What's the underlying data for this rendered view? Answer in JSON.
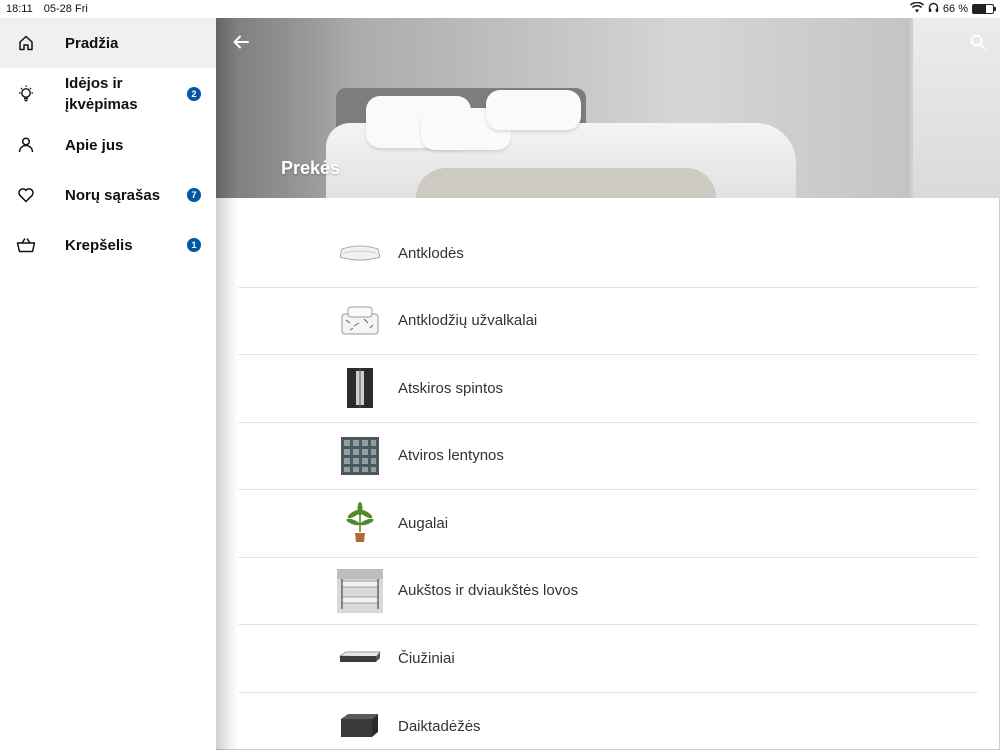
{
  "status_bar": {
    "time": "18:11",
    "date": "05-28 Fri",
    "battery": "66 %"
  },
  "sidebar": {
    "items": [
      {
        "label": "Pradžia",
        "icon": "home-icon"
      },
      {
        "label": "Idėjos ir įkvėpimas",
        "icon": "lightbulb-icon",
        "badge": "2"
      },
      {
        "label": "Apie jus",
        "icon": "person-icon"
      },
      {
        "label": "Norų sąrašas",
        "icon": "heart-icon",
        "badge": "7"
      },
      {
        "label": "Krepšelis",
        "icon": "basket-icon",
        "badge": "1"
      }
    ]
  },
  "hero": {
    "title": "Prekės",
    "back_icon": "arrow-left-icon",
    "search_icon": "search-icon"
  },
  "categories": [
    {
      "label": "Antklodės",
      "icon": "duvet-icon"
    },
    {
      "label": "Antklodžių užvalkalai",
      "icon": "duvet-cover-icon"
    },
    {
      "label": "Atskiros spintos",
      "icon": "wardrobe-icon"
    },
    {
      "label": "Atviros lentynos",
      "icon": "open-shelf-icon"
    },
    {
      "label": "Augalai",
      "icon": "plant-icon"
    },
    {
      "label": "Aukštos ir dviaukštės lovos",
      "icon": "bunk-bed-icon"
    },
    {
      "label": "Čiužiniai",
      "icon": "mattress-icon"
    },
    {
      "label": "Daiktadėžės",
      "icon": "storage-box-icon"
    }
  ]
}
